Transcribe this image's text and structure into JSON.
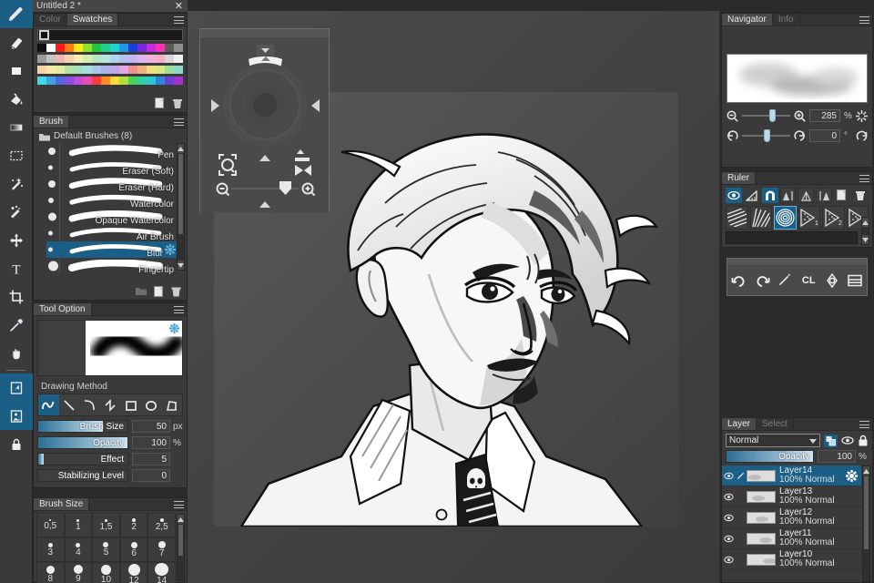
{
  "window": {
    "title": "Untitled 2 *",
    "close_label": "✕"
  },
  "toolbar": {
    "tools": [
      {
        "name": "pen-tool",
        "selected": true
      },
      {
        "name": "eraser-tool",
        "selected": false
      },
      {
        "name": "fill-tool",
        "selected": false
      },
      {
        "name": "bucket-tool",
        "selected": false
      },
      {
        "name": "gradient-tool",
        "selected": false
      },
      {
        "name": "marquee-select-tool",
        "selected": false
      },
      {
        "name": "magic-wand-tool",
        "selected": false
      },
      {
        "name": "decoration-tool",
        "selected": false
      },
      {
        "name": "move-tool",
        "selected": false
      },
      {
        "name": "text-tool",
        "selected": false
      },
      {
        "name": "crop-tool",
        "selected": false
      },
      {
        "name": "eyedropper-tool",
        "selected": false
      },
      {
        "name": "hand-tool",
        "selected": false
      },
      {
        "name": "foreground-swap-tool",
        "selected": true
      },
      {
        "name": "background-swap-tool",
        "selected": true
      },
      {
        "name": "lock-transparency-tool",
        "selected": false
      }
    ]
  },
  "color_panel": {
    "tabs": [
      {
        "label": "Color",
        "active": false
      },
      {
        "label": "Swatches",
        "active": true
      }
    ],
    "swatch_rows": [
      [
        "#111111",
        "#ffffff",
        "#ff1b1b",
        "#ff7a14",
        "#ffe817",
        "#8ee331",
        "#23c641",
        "#20cf8c",
        "#1fd3cf",
        "#2597e8",
        "#1a3fe0",
        "#7a27e0",
        "#c42ae0",
        "#ff2fb8",
        "#5b5b5b",
        "#8f8f8f"
      ],
      [
        "#9b9b9b",
        "#c4c4c4",
        "#f3b6b6",
        "#f6d2ae",
        "#f7eeb3",
        "#d6edb4",
        "#b6e5c2",
        "#b4e6de",
        "#b0d6ef",
        "#b3c1ee",
        "#c6b5ef",
        "#ddb6ef",
        "#f1b2dd",
        "#f2b1c0",
        "#d7d7d7",
        "#efefef"
      ],
      [
        "#f6d2a8",
        "#f7e9a3",
        "#dfeea2",
        "#b6e4a5",
        "#a6e0bd",
        "#a4dede",
        "#a6c6ea",
        "#a9b3e8",
        "#c0a8e6",
        "#e0a6e6",
        "#ef8f8f",
        "#f0b17f",
        "#f4dd7f",
        "#d6e87f",
        "#9fdf9b",
        "#8fd9c8"
      ],
      [
        "#44d7e8",
        "#3ea3e0",
        "#5169dd",
        "#8a4fdd",
        "#c04edd",
        "#e84fb2",
        "#ff3c3c",
        "#ff8a2b",
        "#ffd83a",
        "#b2e03a",
        "#4ad35a",
        "#34cfa3",
        "#2fc5d6",
        "#2f86d9",
        "#6b3fd6",
        "#a832c9"
      ]
    ],
    "footer_icons": [
      "new-swatch-icon",
      "delete-swatch-icon"
    ]
  },
  "brush_panel": {
    "title": "Brush",
    "group_label": "Default Brushes (8)",
    "brushes": [
      {
        "label": "Pen",
        "dot": 8,
        "selected": false
      },
      {
        "label": "Eraser (Soft)",
        "dot": 5,
        "selected": false
      },
      {
        "label": "Eraser (Hard)",
        "dot": 8,
        "selected": false
      },
      {
        "label": "Watercolor",
        "dot": 6,
        "selected": false
      },
      {
        "label": "Opaque Watercolor",
        "dot": 9,
        "selected": false
      },
      {
        "label": "Air Brush",
        "dot": 5,
        "selected": false
      },
      {
        "label": "Blur",
        "dot": 5,
        "selected": true
      },
      {
        "label": "Fingertip",
        "dot": 11,
        "selected": false
      }
    ],
    "footer_icons": [
      "new-folder-icon",
      "duplicate-brush-icon",
      "delete-brush-icon"
    ]
  },
  "tool_option": {
    "title": "Tool Option",
    "settings_icon": "brush-settings-icon",
    "drawing_method": {
      "label": "Drawing Method",
      "items": [
        {
          "name": "freehand",
          "selected": true
        },
        {
          "name": "line",
          "selected": false
        },
        {
          "name": "curve",
          "selected": false
        },
        {
          "name": "polyline",
          "selected": false
        },
        {
          "name": "rectangle",
          "selected": false
        },
        {
          "name": "ellipse",
          "selected": false
        },
        {
          "name": "polygon",
          "selected": false
        }
      ]
    },
    "sliders": [
      {
        "label": "Brush Size",
        "value": "50",
        "unit": "px",
        "fill": 72
      },
      {
        "label": "Opacity",
        "value": "100",
        "unit": "%",
        "fill": 100
      },
      {
        "label": "Effect",
        "value": "5",
        "unit": "",
        "fill": 6
      },
      {
        "label": "Stabilizing Level",
        "value": "0",
        "unit": "",
        "fill": 0
      }
    ]
  },
  "brush_size_panel": {
    "title": "Brush Size",
    "sizes": [
      {
        "label": "0,5",
        "dot": 2
      },
      {
        "label": "1",
        "dot": 3
      },
      {
        "label": "1,5",
        "dot": 3
      },
      {
        "label": "2",
        "dot": 4
      },
      {
        "label": "2,5",
        "dot": 4
      },
      {
        "label": "3",
        "dot": 5
      },
      {
        "label": "4",
        "dot": 5
      },
      {
        "label": "5",
        "dot": 6
      },
      {
        "label": "6",
        "dot": 7
      },
      {
        "label": "7",
        "dot": 8
      },
      {
        "label": "8",
        "dot": 9
      },
      {
        "label": "9",
        "dot": 10
      },
      {
        "label": "10",
        "dot": 11
      },
      {
        "label": "12",
        "dot": 13
      },
      {
        "label": "14",
        "dot": 15
      }
    ]
  },
  "float_navigator": {
    "icons": [
      "rotate-up-icon",
      "pan-left-icon",
      "pan-right-icon",
      "fit-to-screen-icon",
      "flip-horizontal-icon",
      "zoom-out-icon",
      "zoom-in-icon"
    ]
  },
  "navigator_panel": {
    "tabs": [
      {
        "label": "Navigator",
        "active": true
      },
      {
        "label": "Info",
        "active": false
      }
    ],
    "zoom_value": "285",
    "zoom_unit": "%",
    "rotation_value": "0",
    "rotation_unit": "°",
    "icons": [
      "zoom-out-icon",
      "zoom-in-icon",
      "reset-zoom-icon",
      "rotate-left-icon",
      "rotate-right-icon",
      "reset-rotation-icon"
    ]
  },
  "ruler_panel": {
    "title": "Ruler",
    "top_icons": [
      {
        "name": "show-ruler-icon",
        "selected": true
      },
      {
        "name": "ruler-snap-icon",
        "selected": false
      },
      {
        "name": "ruler-magnet-icon",
        "selected": true
      },
      {
        "name": "symmetry-vertical-icon",
        "selected": false
      },
      {
        "name": "symmetry-diagonal-icon",
        "selected": false
      },
      {
        "name": "symmetry-horizontal-icon",
        "selected": false
      },
      {
        "name": "new-ruler-icon",
        "selected": false
      },
      {
        "name": "delete-ruler-icon",
        "selected": false
      }
    ],
    "ruler_types": [
      {
        "name": "parallel-lines-ruler",
        "selected": false
      },
      {
        "name": "radial-lines-ruler",
        "selected": false
      },
      {
        "name": "concentric-circles-ruler",
        "selected": true
      },
      {
        "name": "perspective-1pt-ruler",
        "label": "1",
        "selected": false
      },
      {
        "name": "perspective-2pt-ruler",
        "label": "2",
        "selected": false
      },
      {
        "name": "perspective-3pt-ruler",
        "label": "3",
        "selected": false
      }
    ]
  },
  "float_toolbar": {
    "buttons": [
      {
        "name": "undo-button",
        "glyph": "↶"
      },
      {
        "name": "redo-button",
        "glyph": "↷"
      },
      {
        "name": "pen-button",
        "glyph": "pen"
      },
      {
        "name": "clear-layer-button",
        "glyph": "CL"
      },
      {
        "name": "target-button",
        "glyph": "target"
      },
      {
        "name": "window-button",
        "glyph": "window"
      }
    ]
  },
  "layer_panel": {
    "tabs": [
      {
        "label": "Layer",
        "active": true
      },
      {
        "label": "Select",
        "active": false
      }
    ],
    "blend_mode": "Normal",
    "opacity_label": "Opacity",
    "opacity_value": "100",
    "opacity_unit": "%",
    "header_icons": [
      "clipping-mask-icon",
      "layer-visibility-icon",
      "lock-layer-icon"
    ],
    "layers": [
      {
        "name": "Layer14",
        "meta": "100% Normal",
        "selected": true
      },
      {
        "name": "Layer13",
        "meta": "100% Normal",
        "selected": false
      },
      {
        "name": "Layer12",
        "meta": "100% Normal",
        "selected": false
      },
      {
        "name": "Layer11",
        "meta": "100% Normal",
        "selected": false
      },
      {
        "name": "Layer10",
        "meta": "100% Normal",
        "selected": false
      }
    ]
  },
  "canvas": {
    "artwork_title": "monochrome manga portrait of a man with swept-back hair, shirt collar and skull tie"
  },
  "colors": {
    "accent": "#1b5f86",
    "panel_bg": "#3a3a3a",
    "app_bg": "#2b2b2b",
    "text": "#d8d8d8"
  }
}
